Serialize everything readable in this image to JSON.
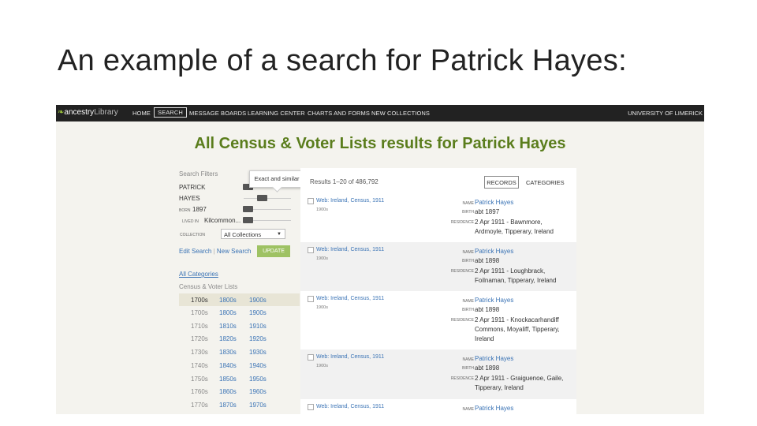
{
  "slide": {
    "title": "An example of a search for Patrick Hayes:"
  },
  "nav": {
    "logo": {
      "icon": "leaf-icon",
      "brand": "ancestry",
      "suffix": "Library"
    },
    "items": [
      "HOME",
      "SEARCH",
      "MESSAGE BOARDS",
      "LEARNING CENTER",
      "CHARTS AND FORMS",
      "NEW COLLECTIONS"
    ],
    "active": "SEARCH",
    "right": "UNIVERSITY OF LIMERICK"
  },
  "page_title": "All Census & Voter Lists results for Patrick Hayes",
  "filters": {
    "label": "Search Filters",
    "first_name": "PATRICK",
    "last_name": "HAYES",
    "born_label": "BORN",
    "born_value": "1897",
    "lived_label": "LIVED IN",
    "lived_value": "Kilcommon...",
    "tooltip": "Exact and similar",
    "collection_label": "COLLECTION",
    "collection_value": "All Collections",
    "edit_search": "Edit Search",
    "new_search": "New Search",
    "update": "UPDATE",
    "all_categories": "All Categories",
    "census_voter": "Census & Voter Lists",
    "decades_head": [
      "1700s",
      "1800s",
      "1900s"
    ],
    "decades": [
      [
        "1700s",
        "1800s",
        "1900s"
      ],
      [
        "1710s",
        "1810s",
        "1910s"
      ],
      [
        "1720s",
        "1820s",
        "1920s"
      ],
      [
        "1730s",
        "1830s",
        "1930s"
      ],
      [
        "1740s",
        "1840s",
        "1940s"
      ],
      [
        "1750s",
        "1850s",
        "1950s"
      ],
      [
        "1760s",
        "1860s",
        "1960s"
      ],
      [
        "1770s",
        "1870s",
        "1970s"
      ]
    ]
  },
  "results": {
    "count_text": "Results 1–20 of 486,792",
    "records_btn": "RECORDS",
    "categories_btn": "CATEGORIES",
    "labels": {
      "name": "NAME",
      "birth": "BIRTH",
      "residence": "RESIDENCE"
    },
    "items": [
      {
        "collection": "Web: Ireland, Census, 1911",
        "year": "1900s",
        "name": "Patrick Hayes",
        "birth": "abt 1897",
        "residence_1": "2 Apr 1911 - Bawnmore,",
        "residence_2": "Ardmoyle, Tipperary, Ireland",
        "residence_3": ""
      },
      {
        "collection": "Web: Ireland, Census, 1911",
        "year": "1900s",
        "name": "Patrick Hayes",
        "birth": "abt 1898",
        "residence_1": "2 Apr 1911 - Loughbrack,",
        "residence_2": "Foilnaman, Tipperary, Ireland",
        "residence_3": ""
      },
      {
        "collection": "Web: Ireland, Census, 1911",
        "year": "1900s",
        "name": "Patrick Hayes",
        "birth": "abt 1898",
        "residence_1": "2 Apr 1911 - Knockacarhandiff",
        "residence_2": "Commons, Moyaliff, Tipperary,",
        "residence_3": "Ireland"
      },
      {
        "collection": "Web: Ireland, Census, 1911",
        "year": "1900s",
        "name": "Patrick Hayes",
        "birth": "abt 1898",
        "residence_1": "2 Apr 1911 - Graiguenoe, Gaile,",
        "residence_2": "Tipperary, Ireland",
        "residence_3": ""
      },
      {
        "collection": "Web: Ireland, Census, 1911",
        "year": "",
        "name": "Patrick Hayes",
        "birth": "",
        "residence_1": "",
        "residence_2": "",
        "residence_3": ""
      }
    ]
  },
  "colors": {
    "accent_green": "#5a7d1c",
    "link_blue": "#3a73b5",
    "nav_bg": "#222222",
    "update_btn": "#9ec263"
  }
}
